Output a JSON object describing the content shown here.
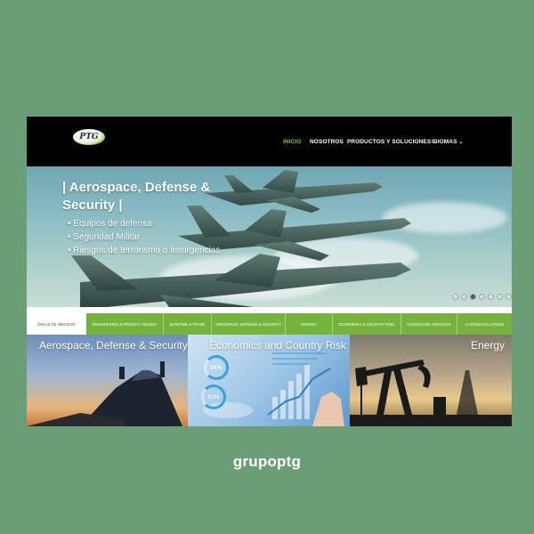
{
  "header": {
    "logo_text": "PTG",
    "nav": [
      {
        "label": "INICIO",
        "active": true,
        "dropdown": false
      },
      {
        "label": "NOSOTROS",
        "active": false,
        "dropdown": false
      },
      {
        "label": "PRODUCTOS Y SOLUCIONES",
        "active": false,
        "dropdown": true
      },
      {
        "label": "IDIOMAS",
        "active": false,
        "dropdown": true
      }
    ],
    "chevron": "⌄"
  },
  "hero": {
    "title": "| Aerospace, Defense & Security |",
    "bullets": [
      "• Equipos de defensa",
      "• Seguridad Militar",
      "• Riesgos de terrorismo o insurgencias"
    ],
    "slide_count": 8,
    "active_slide": 3
  },
  "tabs": [
    "LÍNEAS DE NEGOCIO",
    "ENGINEERING & PRODUCT DESIGN",
    "MARITIME & TRADE",
    "AEROSPACE, DEFENSE & SECURITY",
    "ENERGY",
    "ECONOMICS & COUNTRY RISK",
    "CONSULTING SERVICES",
    "CUSTOM SOLUTIONS"
  ],
  "panels": [
    {
      "title": "Aerospace, Defense & Security"
    },
    {
      "title": "Economics and Country Risk",
      "stats": [
        "86%",
        "62%"
      ]
    },
    {
      "title": "Energy"
    }
  ],
  "caption": "grupoptg",
  "colors": {
    "background": "#6b9e77",
    "accent_green": "#76b33d",
    "nav_active": "#8cc63f",
    "header_bg": "#000000"
  }
}
